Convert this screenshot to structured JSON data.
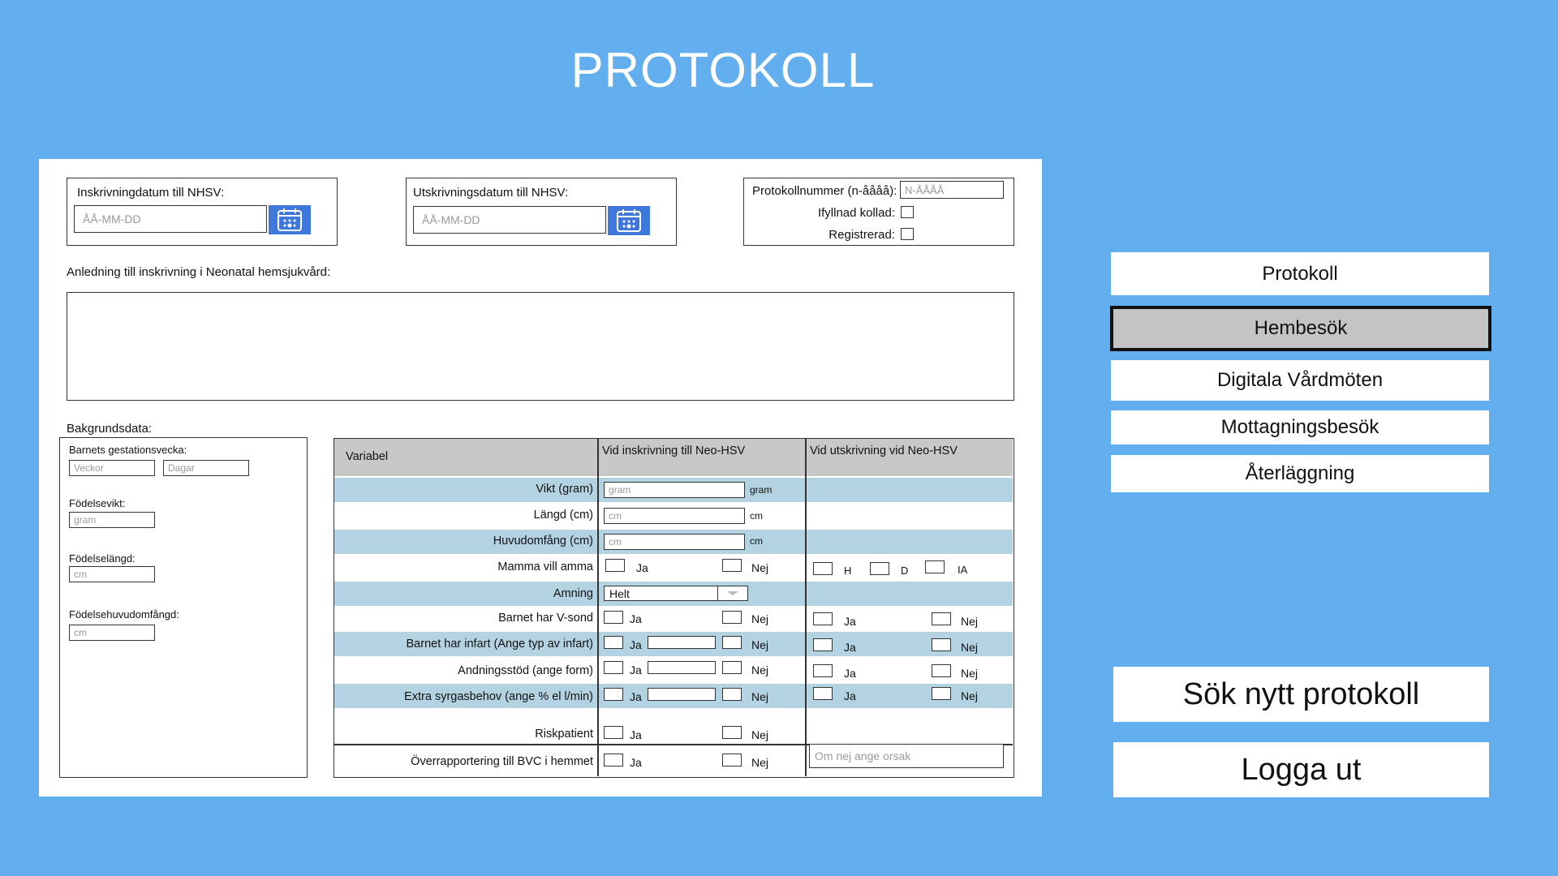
{
  "page": {
    "title": "PROTOKOLL"
  },
  "admission": {
    "label": "Inskrivningdatum till NHSV:",
    "placeholder": "ÅÅ-MM-DD"
  },
  "discharge": {
    "label": "Utskrivningsdatum till NHSV:",
    "placeholder": "ÅÅ-MM-DD"
  },
  "protocol": {
    "number_label": "Protokollnummer (n-åååå):",
    "number_placeholder": "N-ÅÅÅÅ",
    "checked_label": "Ifyllnad kollad:",
    "registered_label": "Registrerad:"
  },
  "reason": {
    "label": "Anledning till inskrivning i Neonatal hemsjukvård:"
  },
  "background": {
    "label": "Bakgrundsdata:",
    "gestation_label": "Barnets gestationsvecka:",
    "weeks_placeholder": "Veckor",
    "days_placeholder": "Dagar",
    "birth_weight_label": "Födelsevikt:",
    "birth_weight_placeholder": "gram",
    "birth_length_label": "Födelselängd:",
    "birth_length_placeholder": "cm",
    "birth_head_label": "Födelsehuvudomfångd:",
    "birth_head_placeholder": "cm"
  },
  "table": {
    "headers": [
      "Variabel",
      "Vid inskrivning till Neo-HSV",
      "Vid utskrivning vid Neo-HSV"
    ],
    "rows": {
      "weight": {
        "label": "Vikt (gram)",
        "placeholder": "gram",
        "unit": "gram"
      },
      "length": {
        "label": "Längd (cm)",
        "placeholder": "cm",
        "unit": "cm"
      },
      "head": {
        "label": "Huvudomfång (cm)",
        "placeholder": "cm",
        "unit": "cm"
      },
      "breastfeed_wish": {
        "label": "Mamma vill amma",
        "yes": "Ja",
        "no": "Nej",
        "out_h": "H",
        "out_d": "D",
        "out_ia": "IA"
      },
      "breastfeeding": {
        "label": "Amning",
        "selected": "Helt"
      },
      "vsond": {
        "label": "Barnet har V-sond",
        "yes": "Ja",
        "no": "Nej"
      },
      "infart": {
        "label": "Barnet har infart (Ange typ av infart)",
        "yes": "Ja",
        "no": "Nej"
      },
      "breathing": {
        "label": "Andningsstöd (ange form)",
        "yes": "Ja",
        "no": "Nej"
      },
      "oxygen": {
        "label": "Extra syrgasbehov (ange % el l/min)",
        "yes": "Ja",
        "no": "Nej"
      },
      "risk": {
        "label": "Riskpatient",
        "yes": "Ja",
        "no": "Nej"
      },
      "handover": {
        "label": "Överrapportering till BVC i hemmet",
        "yes": "Ja",
        "no": "Nej",
        "reason_placeholder": "Om nej ange orsak"
      }
    }
  },
  "nav": {
    "items": [
      "Protokoll",
      "Hembesök",
      "Digitala Vårdmöten",
      "Mottagningsbesök",
      "Återläggning"
    ],
    "active": "Hembesök"
  },
  "actions": {
    "search_new": "Sök nytt protokoll",
    "logout": "Logga ut"
  },
  "colors": {
    "background": "#62AEEE",
    "calendar": "#3F77DB",
    "row_highlight": "#B3D3E2",
    "header_gray": "#C8C8C8",
    "nav_active": "#C4C4C4"
  }
}
